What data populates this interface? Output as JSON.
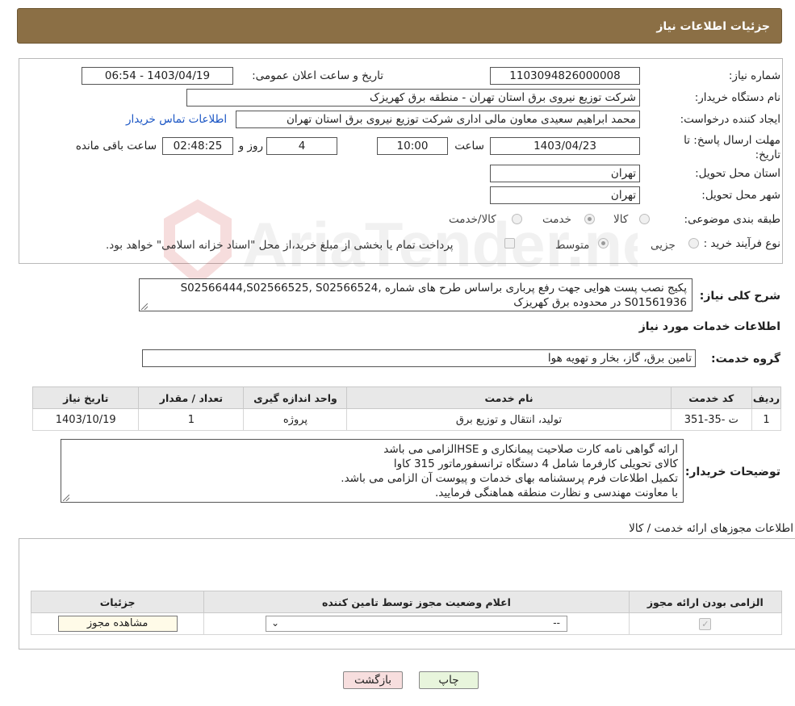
{
  "header": {
    "title": "جزئیات اطلاعات نیاز"
  },
  "form": {
    "need_number_label": "شماره نیاز:",
    "need_number": "1103094826000008",
    "announce_label": "تاریخ و ساعت اعلان عمومی:",
    "announce_value": "1403/04/19 - 06:54",
    "buyer_org_label": "نام دستگاه خریدار:",
    "buyer_org": "شرکت توزیع نیروی برق استان تهران  - منطقه برق کهریزک",
    "creator_label": "ایجاد کننده درخواست:",
    "creator": "محمد ابراهیم  سعیدی معاون مالی اداری  شرکت توزیع نیروی برق استان تهران",
    "contact_link": "اطلاعات تماس خریدار",
    "deadline_label_1": "مهلت ارسال پاسخ: تا",
    "deadline_label_2": "تاریخ:",
    "deadline_date": "1403/04/23",
    "time_label": "ساعت",
    "deadline_time": "10:00",
    "days_value": "4",
    "days_label": "روز و",
    "remaining_value": "02:48:25",
    "remaining_label": "ساعت باقی مانده",
    "province_label": "استان محل تحویل:",
    "province": "تهران",
    "city_label": "شهر محل تحویل:",
    "city": "تهران",
    "category_label": "طبقه بندی موضوعی:",
    "category_options": [
      "کالا",
      "خدمت",
      "کالا/خدمت"
    ],
    "category_selected": 1,
    "process_label": "نوع فرآیند خرید :",
    "process_options": [
      "جزیی",
      "متوسط"
    ],
    "process_selected": 1,
    "process_note": "پرداخت تمام یا بخشی از مبلغ خرید،از محل \"اسناد خزانه اسلامی\" خواهد بود."
  },
  "summary": {
    "label": "شرح کلی نیاز:",
    "line1": "پکیج نصب پست هوایی جهت رفع پرباری براساس طرح های شماره   ,S02566444,S02566525, S02566524",
    "line2": "S01561936 در محدوده برق کهریزک"
  },
  "services": {
    "section_title": "اطلاعات خدمات مورد نیاز",
    "group_label": "گروه خدمت:",
    "group_value": "تامین برق، گاز، بخار و تهویه هوا",
    "columns": [
      "ردیف",
      "کد خدمت",
      "نام خدمت",
      "واحد اندازه گیری",
      "تعداد / مقدار",
      "تاریخ نیاز"
    ],
    "rows": [
      [
        "1",
        "ت -35-351",
        "تولید، انتقال و توزیع برق",
        "پروژه",
        "1",
        "1403/10/19"
      ]
    ]
  },
  "buyer_notes": {
    "label": "توضیحات خریدار:",
    "lines": [
      "ارائه گواهی نامه کارت صلاحیت پیمانکاری و HSEالزامی می باشد",
      "کالای تحویلی کارفرما شامل 4 دستگاه ترانسفورماتور 315 کاوا",
      "تکمیل اطلاعات فرم پرسشنامه بهای خدمات و پیوست آن الزامی می باشد.",
      "با معاونت مهندسی و نظارت منطقه هماهنگی فرمایید."
    ]
  },
  "permits": {
    "section_title": "اطلاعات مجوزهای ارائه خدمت / کالا",
    "columns": [
      "الزامی بودن ارائه مجوز",
      "اعلام وضعیت مجوز توسط تامین کننده",
      "جزئیات"
    ],
    "select_value": "--",
    "view_button": "مشاهده مجوز"
  },
  "footer": {
    "print_button": "چاپ",
    "back_button": "بازگشت"
  },
  "watermark_text": "AriaTender.neT",
  "colors": {
    "header_bg": "#8b6f45",
    "link": "#1a55c4",
    "back_btn": "#f7dede",
    "print_btn": "#e8f5dc"
  }
}
